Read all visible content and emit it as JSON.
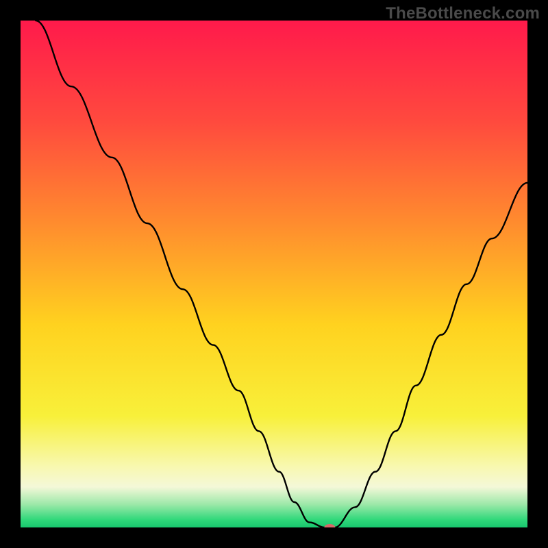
{
  "watermark": "TheBottleneck.com",
  "chart_data": {
    "type": "line",
    "title": "",
    "xlabel": "",
    "ylabel": "",
    "xlim": [
      0,
      100
    ],
    "ylim": [
      0,
      100
    ],
    "grid": false,
    "series": [
      {
        "name": "curve",
        "x": [
          3,
          10,
          18,
          25,
          32,
          38,
          43,
          47,
          51,
          54,
          57,
          60,
          62,
          66,
          70,
          74,
          78,
          83,
          88,
          93,
          100
        ],
        "y": [
          100,
          87,
          73,
          60,
          47,
          36,
          27,
          19,
          11,
          5,
          1,
          0,
          0,
          4,
          11,
          19,
          28,
          38,
          48,
          57,
          68
        ]
      }
    ],
    "marker": {
      "x": 61,
      "y": 0,
      "color": "#d66a6a",
      "rx": 8,
      "ry": 5
    },
    "gradient_stops": [
      {
        "offset": 0.0,
        "color": "#ff1a4b"
      },
      {
        "offset": 0.2,
        "color": "#ff4a3e"
      },
      {
        "offset": 0.4,
        "color": "#ff8c2e"
      },
      {
        "offset": 0.6,
        "color": "#ffd21f"
      },
      {
        "offset": 0.78,
        "color": "#f8f03a"
      },
      {
        "offset": 0.88,
        "color": "#f8f8b0"
      },
      {
        "offset": 0.92,
        "color": "#f4f8d8"
      },
      {
        "offset": 0.955,
        "color": "#9be8a8"
      },
      {
        "offset": 0.985,
        "color": "#2fd87a"
      },
      {
        "offset": 1.0,
        "color": "#18c76e"
      }
    ]
  }
}
